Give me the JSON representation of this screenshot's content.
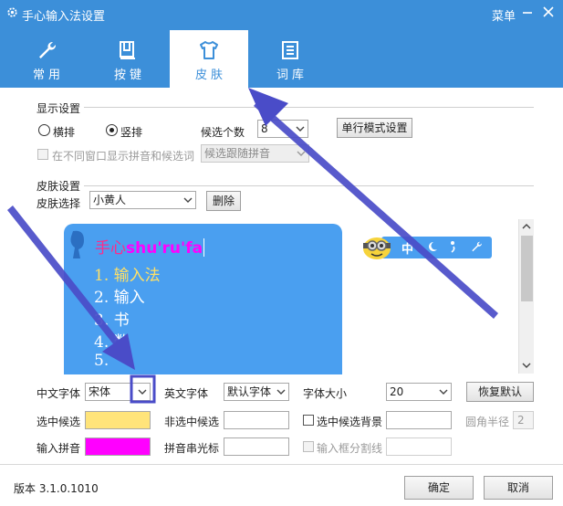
{
  "window": {
    "title": "手心输入法设置",
    "menu_label": "菜单",
    "accent_color": "#3c8fd9"
  },
  "tabs": [
    {
      "label": "常用",
      "icon": "wrench-icon",
      "active": false
    },
    {
      "label": "按键",
      "icon": "key-icon",
      "active": false
    },
    {
      "label": "皮肤",
      "icon": "tshirt-icon",
      "active": true
    },
    {
      "label": "词库",
      "icon": "dictionary-icon",
      "active": false
    }
  ],
  "display": {
    "section_title": "显示设置",
    "horizontal_label": "横排",
    "vertical_label": "竖排",
    "selected_orientation": "竖排",
    "candidate_count_label": "候选个数",
    "candidate_count_value": "8",
    "single_line_button": "单行模式设置",
    "split_window_label": "在不同窗口显示拼音和候选词",
    "follow_pinyin_value": "候选跟随拼音"
  },
  "skin": {
    "section_title": "皮肤设置",
    "select_label": "皮肤选择",
    "select_value": "小黄人",
    "delete_button": "删除"
  },
  "preview": {
    "input_prefix": "手心",
    "pinyin": "shu'ru'fa",
    "candidates": [
      "1. 输入法",
      "2. 输入",
      "3. 书",
      "4. 数",
      "5."
    ],
    "panel_color": "#4a9ff0",
    "status_char": "中"
  },
  "fonts": {
    "chinese_font_label": "中文字体",
    "chinese_font_value": "宋体",
    "english_font_label": "英文字体",
    "english_font_value": "默认字体",
    "font_size_label": "字体大小",
    "font_size_value": "20",
    "restore_button": "恢复默认"
  },
  "colors": {
    "selected_candidate_label": "选中候选",
    "selected_candidate_color": "#ffe47a",
    "unselected_candidate_label": "非选中候选",
    "selected_bg_label": "选中候选背景",
    "corner_radius_label": "圆角半径",
    "corner_radius_value": "2",
    "input_pinyin_label": "输入拼音",
    "input_pinyin_color": "#ff00ff",
    "pinyin_cursor_label": "拼音串光标",
    "input_box_divider_label": "输入框分割线"
  },
  "footer": {
    "version_label": "版本 3.1.0.1010",
    "ok_button": "确定",
    "cancel_button": "取消"
  }
}
